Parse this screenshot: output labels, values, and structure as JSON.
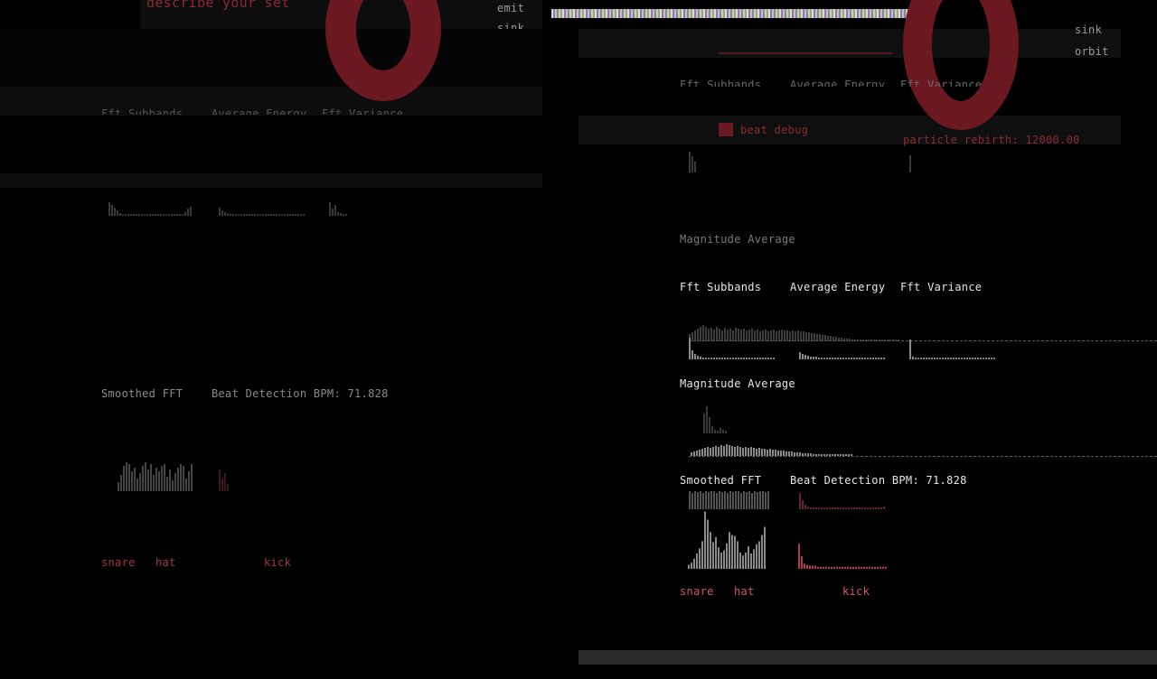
{
  "ghost_panel": {
    "title": "describe your set",
    "menu": [
      "emit",
      "sink"
    ],
    "fft_header": [
      "Fft Subbands",
      "Average Energy",
      "Fft Variance"
    ],
    "smoothed_label": "Smoothed FFT",
    "beat_label": "Beat Detection BPM: 71.828",
    "drums": [
      "snare",
      "hat",
      "kick"
    ]
  },
  "top_panel": {
    "menu": [
      "sink",
      "orbit"
    ],
    "fft_header": [
      "Fft Subbands",
      "Average Energy",
      "Fft Variance"
    ],
    "beat_debug_label": "beat debug",
    "particle_rebirth": "particle rebirth: 12000.00"
  },
  "main_panel": {
    "magnitude_ghost_label": "Magnitude Average",
    "fft_header": [
      "Fft Subbands",
      "Average Energy",
      "Fft Variance"
    ],
    "magnitude_label": "Magnitude Average",
    "smoothed_label": "Smoothed FFT",
    "beat_label": "Beat Detection BPM: 71.828",
    "drums": [
      "snare",
      "hat",
      "kick"
    ]
  },
  "colors": {
    "accent_red": "#6b1820",
    "drum_label": "#c0485a",
    "bar_gray": "#8a8a8a"
  },
  "chart_data": [
    {
      "type": "bar",
      "series": [
        {
          "values": [
            4,
            6,
            10,
            15,
            20,
            27,
            56,
            48,
            36,
            26,
            31,
            21,
            16,
            18,
            25,
            36,
            33,
            32,
            27,
            16,
            13,
            16,
            22,
            15,
            19,
            24,
            27,
            33,
            41
          ]
        }
      ]
    },
    {
      "type": "bar",
      "series": [
        {
          "values": [
            24,
            12,
            5,
            4,
            3,
            3,
            3,
            2,
            2,
            2,
            2,
            2,
            2,
            2,
            2,
            2,
            2,
            2,
            2,
            2,
            2,
            2,
            2,
            2,
            2,
            2,
            2,
            2,
            2,
            2,
            2,
            2,
            2,
            2,
            2,
            2,
            2,
            2
          ]
        }
      ]
    }
  ]
}
